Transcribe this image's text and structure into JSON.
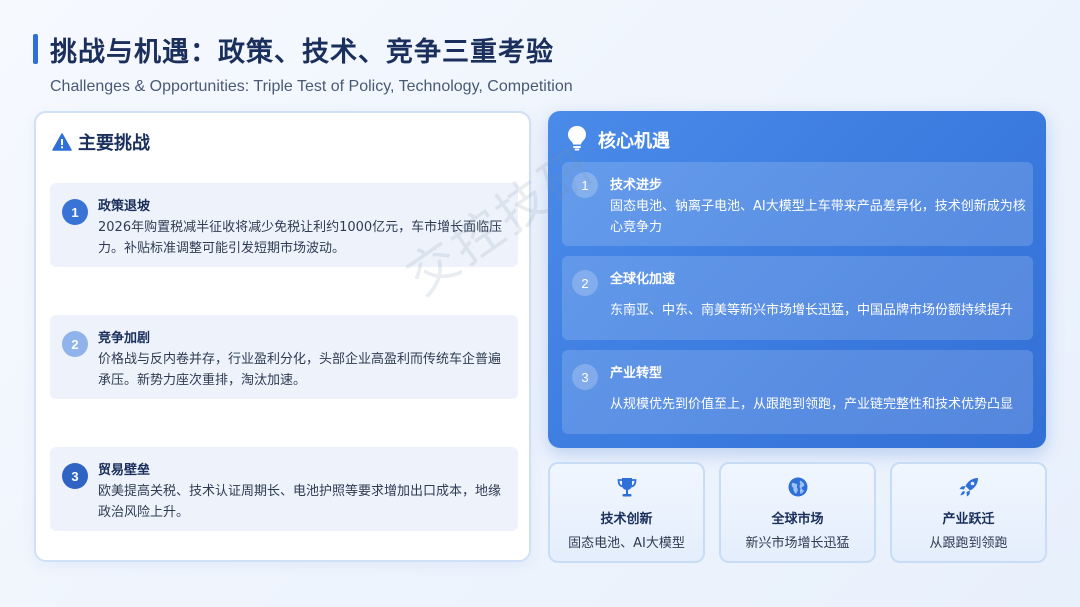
{
  "header": {
    "title": "挑战与机遇：政策、技术、竞争三重考验",
    "subtitle": "Challenges & Opportunities: Triple Test of Policy, Technology, Competition"
  },
  "challenges": {
    "title": "主要挑战",
    "icon": "warning-icon",
    "items": [
      {
        "num": "1",
        "title": "政策退坡",
        "desc": "2026年购置税减半征收将减少免税让利约1000亿元，车市增长面临压力。补贴标准调整可能引发短期市场波动。",
        "color": "#3a73d6"
      },
      {
        "num": "2",
        "title": "竞争加剧",
        "desc": "价格战与反内卷并存，行业盈利分化，头部企业高盈利而传统车企普遍承压。新势力座次重排，淘汰加速。",
        "color": "#8fb3ea"
      },
      {
        "num": "3",
        "title": "贸易壁垒",
        "desc": "欧美提高关税、技术认证周期长、电池护照等要求增加出口成本，地缘政治风险上升。",
        "color": "#2f64c4"
      }
    ]
  },
  "opportunities": {
    "title": "核心机遇",
    "icon": "lightbulb-icon",
    "items": [
      {
        "num": "1",
        "title": "技术进步",
        "desc": "固态电池、钠离子电池、AI大模型上车带来产品差异化，技术创新成为核心竞争力"
      },
      {
        "num": "2",
        "title": "全球化加速",
        "desc": "东南亚、中东、南美等新兴市场增长迅猛，中国品牌市场份额持续提升"
      },
      {
        "num": "3",
        "title": "产业转型",
        "desc": "从规模优先到价值至上，从跟跑到领跑，产业链完整性和技术优势凸显"
      }
    ]
  },
  "cards": [
    {
      "icon": "trophy-icon",
      "title": "技术创新",
      "sub": "固态电池、AI大模型"
    },
    {
      "icon": "globe-icon",
      "title": "全球市场",
      "sub": "新兴市场增长迅猛"
    },
    {
      "icon": "rocket-icon",
      "title": "产业跃迁",
      "sub": "从跟跑到领跑"
    }
  ],
  "watermark": "交控技研",
  "colors": {
    "accent": "#2f6fd8",
    "panel_blue": "#3a79de",
    "dark_text": "#1b2f5c"
  }
}
